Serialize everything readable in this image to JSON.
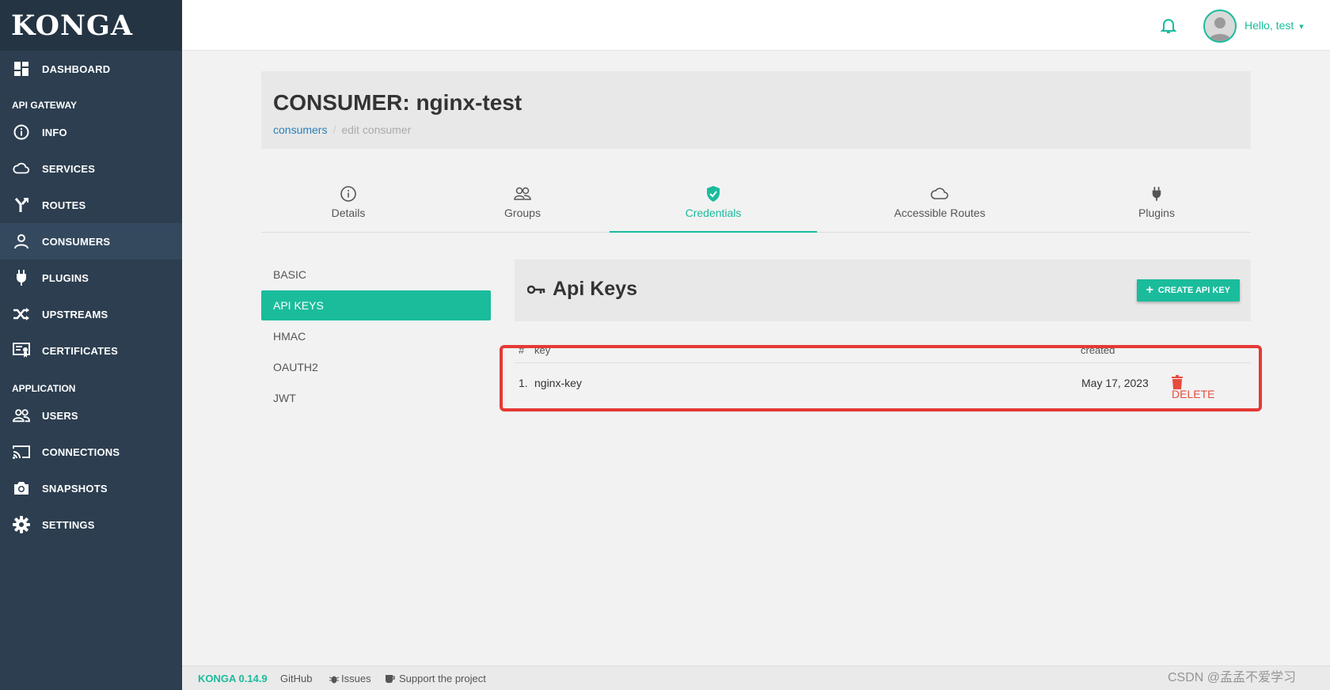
{
  "sidebar": {
    "logo": "KONGA",
    "items": [
      {
        "label": "DASHBOARD",
        "icon": "dashboard-icon"
      },
      {
        "section": "API GATEWAY"
      },
      {
        "label": "INFO",
        "icon": "info-icon"
      },
      {
        "label": "SERVICES",
        "icon": "cloud-icon"
      },
      {
        "label": "ROUTES",
        "icon": "routes-icon"
      },
      {
        "label": "CONSUMERS",
        "icon": "user-icon",
        "active": true
      },
      {
        "label": "PLUGINS",
        "icon": "plug-icon"
      },
      {
        "label": "UPSTREAMS",
        "icon": "shuffle-icon"
      },
      {
        "label": "CERTIFICATES",
        "icon": "certificate-icon"
      },
      {
        "section": "APPLICATION"
      },
      {
        "label": "USERS",
        "icon": "users-icon"
      },
      {
        "label": "CONNECTIONS",
        "icon": "cast-icon"
      },
      {
        "label": "SNAPSHOTS",
        "icon": "camera-icon"
      },
      {
        "label": "SETTINGS",
        "icon": "gear-icon"
      }
    ]
  },
  "topbar": {
    "greeting": "Hello, test",
    "caret": "▾"
  },
  "header": {
    "title": "CONSUMER: nginx-test",
    "breadcrumb": {
      "link": "consumers",
      "separator": "/",
      "current": "edit consumer"
    }
  },
  "tabs": [
    {
      "label": "Details",
      "icon": "info-icon"
    },
    {
      "label": "Groups",
      "icon": "users-icon"
    },
    {
      "label": "Credentials",
      "icon": "shield-icon",
      "active": true
    },
    {
      "label": "Accessible Routes",
      "icon": "cloud-icon"
    },
    {
      "label": "Plugins",
      "icon": "plug-icon"
    }
  ],
  "credentials_nav": [
    "BASIC",
    "API KEYS",
    "HMAC",
    "OAUTH2",
    "JWT"
  ],
  "api_keys": {
    "title": "Api Keys",
    "create_label": "CREATE API KEY",
    "columns": {
      "num": "#",
      "key": "key",
      "created": "created"
    },
    "rows": [
      {
        "num": "1.",
        "key": "nginx-key",
        "created": "May 17, 2023",
        "action": "DELETE"
      }
    ]
  },
  "footer": {
    "version": "KONGA 0.14.9",
    "github": "GitHub",
    "issues": "Issues",
    "support": "Support the project"
  },
  "watermark": "CSDN @孟孟不爱学习",
  "colors": {
    "accent": "#1abc9c",
    "sidebar": "#2c3e50",
    "danger": "#e74c3c",
    "highlight_box": "#e53935"
  }
}
